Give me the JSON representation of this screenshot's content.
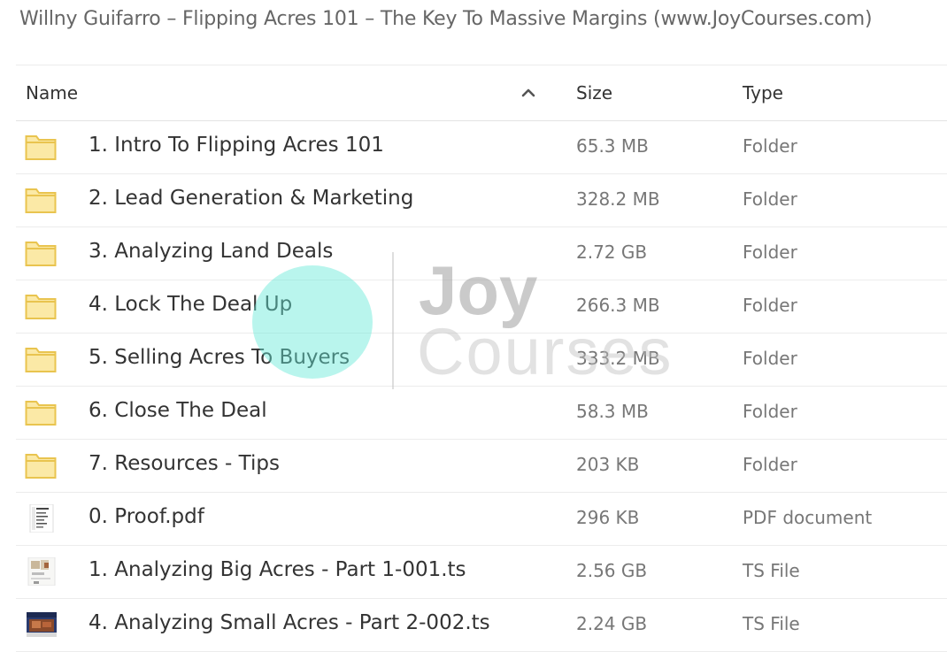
{
  "title": "Willny Guifarro – Flipping Acres 101 – The Key To Massive Margins (www.JoyCourses.com)",
  "columns": {
    "name": "Name",
    "size": "Size",
    "type": "Type",
    "sort_icon": "chevron-up-icon"
  },
  "files": [
    {
      "name": "1. Intro To Flipping Acres 101",
      "size": "65.3 MB",
      "type": "Folder",
      "icon": "folder-icon"
    },
    {
      "name": "2. Lead Generation & Marketing",
      "size": "328.2 MB",
      "type": "Folder",
      "icon": "folder-icon"
    },
    {
      "name": "3. Analyzing Land Deals",
      "size": "2.72 GB",
      "type": "Folder",
      "icon": "folder-icon"
    },
    {
      "name": "4. Lock The Deal Up",
      "size": "266.3 MB",
      "type": "Folder",
      "icon": "folder-icon"
    },
    {
      "name": "5. Selling Acres To Buyers",
      "size": "333.2 MB",
      "type": "Folder",
      "icon": "folder-icon"
    },
    {
      "name": "6. Close The Deal",
      "size": "58.3 MB",
      "type": "Folder",
      "icon": "folder-icon"
    },
    {
      "name": "7. Resources - Tips",
      "size": "203 KB",
      "type": "Folder",
      "icon": "folder-icon"
    },
    {
      "name": "0. Proof.pdf",
      "size": "296 KB",
      "type": "PDF document",
      "icon": "pdf-thumbnail-icon"
    },
    {
      "name": "1. Analyzing Big Acres - Part 1-001.ts",
      "size": "2.56 GB",
      "type": "TS File",
      "icon": "video-thumbnail-icon"
    },
    {
      "name": "4. Analyzing Small Acres - Part 2-002.ts",
      "size": "2.24 GB",
      "type": "TS File",
      "icon": "video-thumbnail-icon"
    }
  ],
  "watermark": {
    "line1": "Joy",
    "line2": "Courses"
  },
  "colors": {
    "folder_fill": "#fbe9a6",
    "folder_stroke": "#e9c44f",
    "watermark_circle": "#64e8d8"
  }
}
